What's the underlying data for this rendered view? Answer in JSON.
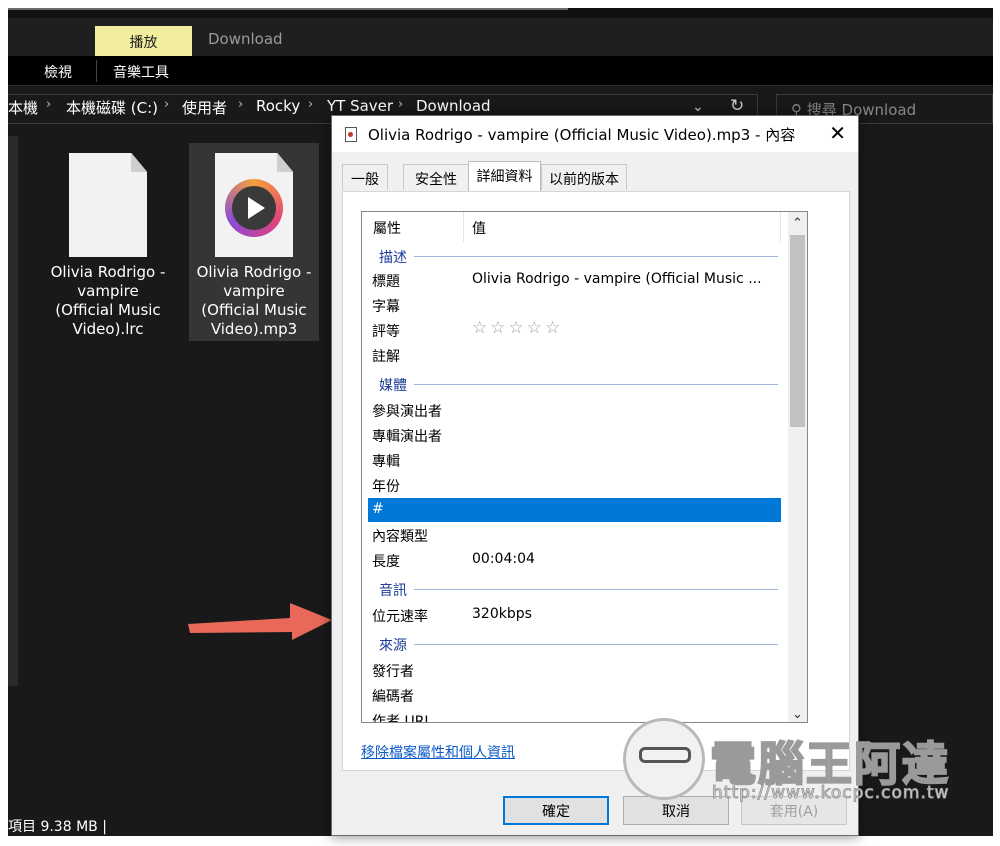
{
  "ribbon": {
    "tab_play": "播放",
    "tab_download": "Download",
    "sub_view": "檢視",
    "sub_music_tools": "音樂工具"
  },
  "address": {
    "crumbs": [
      "本機",
      "本機磁碟 (C:)",
      "使用者",
      "Rocky",
      "YT Saver",
      "Download"
    ],
    "search_placeholder": "搜尋 Download"
  },
  "files": [
    {
      "name": "Olivia Rodrigo - vampire (Official Music Video).lrc",
      "line1": "Olivia Rodrigo -",
      "line2": "vampire",
      "line3": "(Official Music",
      "line4": "Video).lrc"
    },
    {
      "name": "Olivia Rodrigo - vampire (Official Music Video).mp3",
      "line1": "Olivia Rodrigo -",
      "line2": "vampire",
      "line3": "(Official Music",
      "line4": "Video).mp3"
    }
  ],
  "status": {
    "text": "項目  9.38 MB  |"
  },
  "dialog": {
    "title": "Olivia Rodrigo - vampire (Official Music Video).mp3 - 內容",
    "tabs": [
      "一般",
      "安全性",
      "詳細資料",
      "以前的版本"
    ],
    "active_tab": "詳細資料",
    "col_property": "屬性",
    "col_value": "值",
    "groups": {
      "description": "描述",
      "media": "媒體",
      "audio": "音訊",
      "origin": "來源"
    },
    "rows": {
      "title_k": "標題",
      "title_v": "Olivia Rodrigo - vampire (Official Music ...",
      "subtitle_k": "字幕",
      "rating_k": "評等",
      "rating_stars": "☆☆☆☆☆",
      "rating_value": 0,
      "comment_k": "註解",
      "contrib_k": "參與演出者",
      "album_artist_k": "專輯演出者",
      "album_k": "專輯",
      "year_k": "年份",
      "track_k": "#",
      "genre_k": "內容類型",
      "length_k": "長度",
      "length_v": "00:04:04",
      "bitrate_k": "位元速率",
      "bitrate_v": "320kbps",
      "publisher_k": "發行者",
      "encoder_k": "編碼者",
      "author_url_k": "作者 URL"
    },
    "remove_link": "移除檔案屬性和個人資訊",
    "ok": "確定",
    "cancel": "取消",
    "apply": "套用(A)"
  },
  "watermark": {
    "brand": "電腦王阿達",
    "url": "http://www.kocpc.com.tw"
  },
  "colors": {
    "selection": "#0078d7",
    "arrow": "#e8695a",
    "ribbon_tab": "#f3ee9e"
  }
}
